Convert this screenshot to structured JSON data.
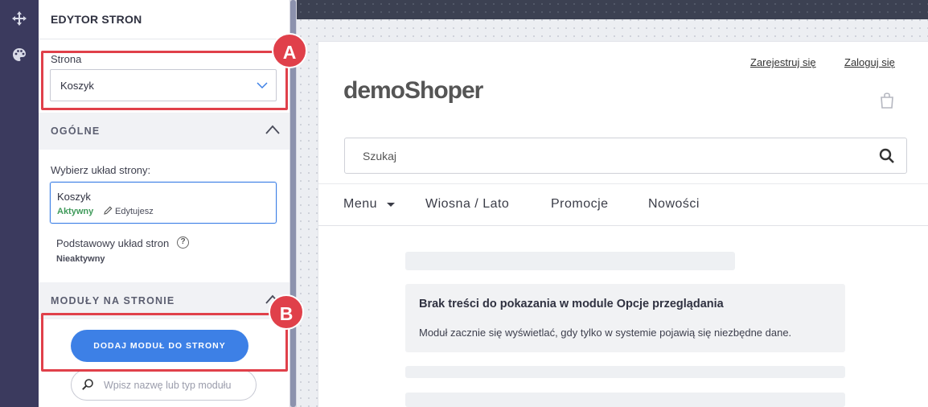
{
  "rail": {
    "icons": [
      "move-icon",
      "palette-icon"
    ]
  },
  "panel": {
    "title": "EDYTOR STRON",
    "page_label": "Strona",
    "page_select_value": "Koszyk",
    "section_general": "OGÓLNE",
    "choose_layout_label": "Wybierz układ strony:",
    "selected_layout": {
      "name": "Koszyk",
      "status": "Aktywny",
      "edit_label": "Edytujesz"
    },
    "base_layout": {
      "name": "Podstawowy układ stron",
      "status": "Nieaktywny"
    },
    "section_modules": "MODUŁY NA STRONIE",
    "add_module_button": "DODAJ MODUŁ DO STRONY",
    "module_search_placeholder": "Wpisz nazwę lub typ modułu"
  },
  "annotations": {
    "a": "A",
    "b": "B",
    "color": "#e0404a"
  },
  "preview": {
    "register_link": "Zarejestruj się",
    "login_link": "Zaloguj się",
    "logo": "demoShoper",
    "search_placeholder": "Szukaj",
    "nav": [
      "Menu",
      "Wiosna / Lato",
      "Promocje",
      "Nowości"
    ],
    "info_title": "Brak treści do pokazania w module Opcje przeglądania",
    "info_text": "Moduł zacznie się wyświetlać, gdy tylko w systemie pojawią się niezbędne dane."
  },
  "colors": {
    "accent": "#3d80e6",
    "active_green": "#3f9a5a",
    "rail": "#3b3a5e"
  }
}
